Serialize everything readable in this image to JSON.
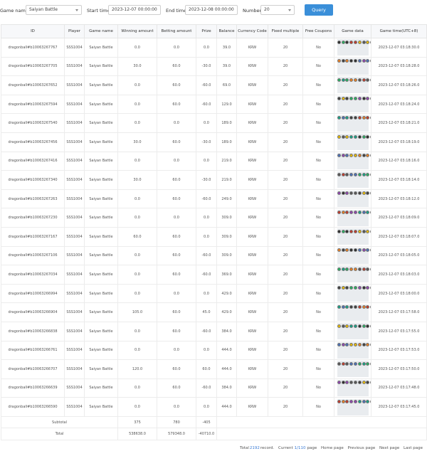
{
  "filters": {
    "game_name_label": "Game name",
    "game_name_value": "Saiyan Battle",
    "start_time_label": "Start time",
    "start_time_value": "2023-12-07 00:00:00",
    "end_time_label": "End time",
    "end_time_value": "2023-12-08 00:00:00",
    "number_label": "Number",
    "number_value": "20",
    "query_label": "Query"
  },
  "table": {
    "headers": [
      "ID",
      "Player",
      "Game name",
      "Winning amount",
      "Betting amount",
      "Prize",
      "Balance",
      "Currency Code",
      "Fixed multiple",
      "Free Coupons",
      "Game data",
      "Game time(UTC+8)"
    ],
    "rows": [
      [
        "dragonball#b10063267767",
        "SSS1004",
        "Saiyan Battle",
        "0.0",
        "0.0",
        "0.0",
        "39.0",
        "KRW",
        "20",
        "No",
        "2023-12-07 03:18:30.0"
      ],
      [
        "dragonball#b10063267705",
        "SSS1004",
        "Saiyan Battle",
        "30.0",
        "60.0",
        "-30.0",
        "39.0",
        "KRW",
        "20",
        "No",
        "2023-12-07 03:18:28.0"
      ],
      [
        "dragonball#b10063267652",
        "SSS1004",
        "Saiyan Battle",
        "0.0",
        "60.0",
        "-60.0",
        "69.0",
        "KRW",
        "20",
        "No",
        "2023-12-07 03:18:26.0"
      ],
      [
        "dragonball#b10063267594",
        "SSS1004",
        "Saiyan Battle",
        "0.0",
        "60.0",
        "-60.0",
        "129.0",
        "KRW",
        "20",
        "No",
        "2023-12-07 03:18:24.0"
      ],
      [
        "dragonball#b10063267540",
        "SSS1004",
        "Saiyan Battle",
        "0.0",
        "0.0",
        "0.0",
        "189.0",
        "KRW",
        "20",
        "No",
        "2023-12-07 03:18:21.0"
      ],
      [
        "dragonball#b10063267456",
        "SSS1004",
        "Saiyan Battle",
        "30.0",
        "60.0",
        "-30.0",
        "189.0",
        "KRW",
        "20",
        "No",
        "2023-12-07 03:18:19.0"
      ],
      [
        "dragonball#b10063267416",
        "SSS1004",
        "Saiyan Battle",
        "0.0",
        "0.0",
        "0.0",
        "219.0",
        "KRW",
        "20",
        "No",
        "2023-12-07 03:18:16.0"
      ],
      [
        "dragonball#b10063267340",
        "SSS1004",
        "Saiyan Battle",
        "30.0",
        "60.0",
        "-30.0",
        "219.0",
        "KRW",
        "20",
        "No",
        "2023-12-07 03:18:14.0"
      ],
      [
        "dragonball#b10063267263",
        "SSS1004",
        "Saiyan Battle",
        "0.0",
        "60.0",
        "-60.0",
        "249.0",
        "KRW",
        "20",
        "No",
        "2023-12-07 03:18:12.0"
      ],
      [
        "dragonball#b10063267230",
        "SSS1004",
        "Saiyan Battle",
        "0.0",
        "0.0",
        "0.0",
        "309.0",
        "KRW",
        "20",
        "No",
        "2023-12-07 03:18:09.0"
      ],
      [
        "dragonball#b10063267167",
        "SSS1004",
        "Saiyan Battle",
        "60.0",
        "60.0",
        "0.0",
        "309.0",
        "KRW",
        "20",
        "No",
        "2023-12-07 03:18:07.0"
      ],
      [
        "dragonball#b10063267106",
        "SSS1004",
        "Saiyan Battle",
        "0.0",
        "60.0",
        "-60.0",
        "309.0",
        "KRW",
        "20",
        "No",
        "2023-12-07 03:18:05.0"
      ],
      [
        "dragonball#b10063267034",
        "SSS1004",
        "Saiyan Battle",
        "0.0",
        "60.0",
        "-60.0",
        "369.0",
        "KRW",
        "20",
        "No",
        "2023-12-07 03:18:03.0"
      ],
      [
        "dragonball#b10063266994",
        "SSS1004",
        "Saiyan Battle",
        "0.0",
        "0.0",
        "0.0",
        "429.0",
        "KRW",
        "20",
        "No",
        "2023-12-07 03:18:00.0"
      ],
      [
        "dragonball#b10063266904",
        "SSS1004",
        "Saiyan Battle",
        "105.0",
        "60.0",
        "45.0",
        "429.0",
        "KRW",
        "20",
        "No",
        "2023-12-07 03:17:58.0"
      ],
      [
        "dragonball#b10063266838",
        "SSS1004",
        "Saiyan Battle",
        "0.0",
        "60.0",
        "-60.0",
        "384.0",
        "KRW",
        "20",
        "No",
        "2023-12-07 03:17:55.0"
      ],
      [
        "dragonball#b10063266761",
        "SSS1004",
        "Saiyan Battle",
        "0.0",
        "0.0",
        "0.0",
        "444.0",
        "KRW",
        "20",
        "No",
        "2023-12-07 03:17:53.0"
      ],
      [
        "dragonball#b10063266707",
        "SSS1004",
        "Saiyan Battle",
        "120.0",
        "60.0",
        "60.0",
        "444.0",
        "KRW",
        "20",
        "No",
        "2023-12-07 03:17:50.0"
      ],
      [
        "dragonball#b10063266639",
        "SSS1004",
        "Saiyan Battle",
        "0.0",
        "60.0",
        "-60.0",
        "384.0",
        "KRW",
        "20",
        "No",
        "2023-12-07 03:17:48.0"
      ],
      [
        "dragonball#b10063266590",
        "SSS1004",
        "Saiyan Battle",
        "0.0",
        "0.0",
        "0.0",
        "444.0",
        "KRW",
        "20",
        "No",
        "2023-12-07 03:17:45.0"
      ]
    ],
    "subtotal": {
      "label": "Subtotal",
      "winning": "375",
      "betting": "780",
      "prize": "-405"
    },
    "total": {
      "label": "Total",
      "winning": "538638.0",
      "betting": "579348.0",
      "prize": "-40710.0"
    }
  },
  "pagination": {
    "total_prefix": "Total",
    "total_count": "2192",
    "total_suffix": "record.",
    "current_prefix": "Current",
    "current_page": "1/110",
    "current_suffix": "page",
    "home": "Home page",
    "previous": "Previous page",
    "next": "Next page",
    "last": "Last page"
  },
  "colors": {
    "accent": "#3a8fd9",
    "link": "#3a7bd5"
  },
  "icons": {
    "select": "chevron-down-icon",
    "game_data": "symbol-grid-icon"
  }
}
